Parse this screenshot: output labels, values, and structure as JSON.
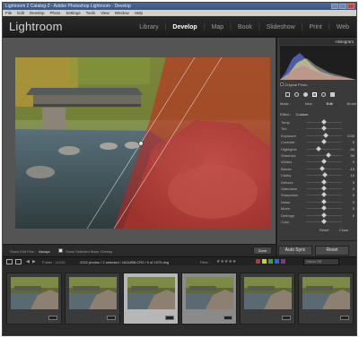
{
  "window": {
    "title": "Lightroom 2 Catalog-2 - Adobe Photoshop Lightroom - Develop"
  },
  "menu": [
    "File",
    "Edit",
    "Develop",
    "Photo",
    "Settings",
    "Tools",
    "View",
    "Window",
    "Help"
  ],
  "brand": "Lightroom",
  "modules": [
    {
      "label": "Library",
      "active": false
    },
    {
      "label": "Develop",
      "active": true
    },
    {
      "label": "Map",
      "active": false
    },
    {
      "label": "Book",
      "active": false
    },
    {
      "label": "Slideshow",
      "active": false
    },
    {
      "label": "Print",
      "active": false
    },
    {
      "label": "Web",
      "active": false
    }
  ],
  "panel": {
    "histogram_label": "Histogram",
    "original_photo_label": "Original Photo",
    "mask_tabs": [
      "Mask :",
      "New",
      "Edit",
      "Brush"
    ],
    "effect_label": "Effect :",
    "effect_value": "Custom",
    "sliders": [
      {
        "label": "Temp",
        "pos": 0.5
      },
      {
        "label": "Tint",
        "pos": 0.5
      },
      {
        "label": "Exposure",
        "pos": 0.55,
        "value": "0.00"
      },
      {
        "label": "Contrast",
        "pos": 0.5,
        "value": "0"
      },
      {
        "label": "Highlights",
        "pos": 0.35,
        "value": "-30"
      },
      {
        "label": "Shadows",
        "pos": 0.62,
        "value": "30"
      },
      {
        "label": "Whites",
        "pos": 0.5,
        "value": "0"
      },
      {
        "label": "Blacks",
        "pos": 0.45,
        "value": "-15"
      },
      {
        "label": "Clarity",
        "pos": 0.52,
        "value": "10"
      },
      {
        "label": "Dehaze",
        "pos": 0.5,
        "value": "0"
      },
      {
        "label": "Saturation",
        "pos": 0.5,
        "value": "0"
      },
      {
        "label": "Sharpness",
        "pos": 0.5,
        "value": "0"
      },
      {
        "label": "Noise",
        "pos": 0.5,
        "value": "0"
      },
      {
        "label": "Moire",
        "pos": 0.5,
        "value": "0"
      },
      {
        "label": "Defringe",
        "pos": 0.5,
        "value": "0"
      },
      {
        "label": "Color",
        "pos": 0.5
      }
    ],
    "reset_label": "Reset",
    "close_label": "Close",
    "previous_label": "Previous",
    "sync_label": "Auto Sync",
    "reset_btn_label": "Reset"
  },
  "toolbar": {
    "show_edit_pins_label": "Show Edit Pins :",
    "show_edit_pins_value": "Always",
    "mask_overlay_label": "Show Selected Mask Overlay",
    "done_label": "Done"
  },
  "filmstrip": {
    "folder": "Folder : 11010",
    "count": "2022 photos / 2 selected / 1611808.CR2 / 9 of 1970.dng",
    "filter_label": "Filter :",
    "filters_off": "Filters Off"
  },
  "colors": {
    "mask_overlay": "#c8201e",
    "active_module": "#ffffff",
    "panel_bg": "#3a3a3a"
  }
}
